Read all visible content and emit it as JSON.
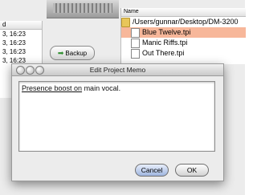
{
  "background": {
    "left_list": {
      "header": "d",
      "rows": [
        "3, 16:23",
        "3, 16:23",
        "3, 16:23",
        "3, 16:23"
      ]
    },
    "backup_button": {
      "label": "Backup",
      "icon": "arrow-right-icon"
    },
    "file_browser": {
      "column_header": "Name",
      "path": "/Users/gunnar/Desktop/DM-3200",
      "files": [
        {
          "name": "Blue Twelve.tpi",
          "selected": true
        },
        {
          "name": "Manic Riffs.tpi",
          "selected": false
        },
        {
          "name": "Out There.tpi",
          "selected": false
        }
      ]
    }
  },
  "dialog": {
    "title": "Edit Project Memo",
    "memo": {
      "underlined_part_1": "Presence boost",
      "underlined_part_2": " on",
      "rest": " main vocal."
    },
    "buttons": {
      "cancel": "Cancel",
      "ok": "OK"
    }
  }
}
